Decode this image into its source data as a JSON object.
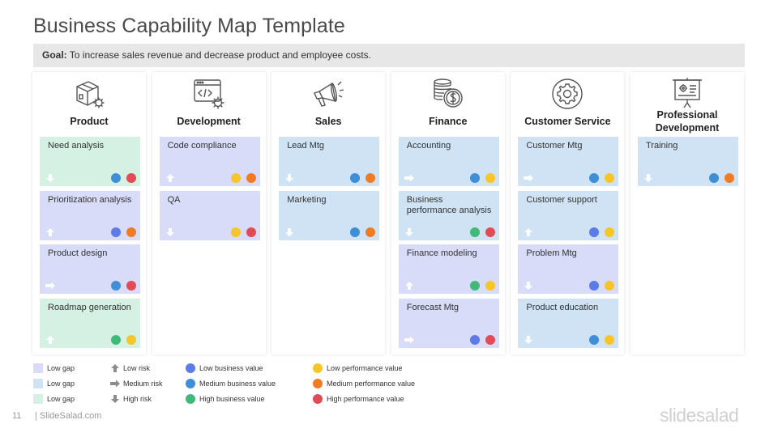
{
  "title": "Business Capability Map Template",
  "goal": {
    "label": "Goal:",
    "text": "To increase sales revenue and decrease product and employee costs."
  },
  "colors": {
    "gap_low_1": "#d8dcf8",
    "gap_low_2": "#cfe3f5",
    "gap_low_3": "#d5f1e3",
    "dot_low_business": "#5b7be6",
    "dot_medium_business": "#3f8fd6",
    "dot_high_business": "#3fba79",
    "dot_low_performance": "#f6c628",
    "dot_medium_performance": "#ef7c23",
    "dot_high_performance": "#e24a56",
    "arrow": "#ffffff",
    "legend_arrow": "#8c8c8c"
  },
  "columns": [
    {
      "title": "Product",
      "icon": "product-box-gear-icon",
      "cards": [
        {
          "label": "Need analysis",
          "gap": "green",
          "arrow": "down",
          "dots": [
            "medium_business",
            "high_performance"
          ]
        },
        {
          "label": "Prioritization analysis",
          "gap": "indigo",
          "arrow": "up",
          "dots": [
            "low_business",
            "medium_performance"
          ]
        },
        {
          "label": "Product design",
          "gap": "indigo",
          "arrow": "right",
          "dots": [
            "medium_business",
            "high_performance"
          ]
        },
        {
          "label": "Roadmap generation",
          "gap": "green",
          "arrow": "up",
          "dots": [
            "high_business",
            "low_performance"
          ]
        }
      ]
    },
    {
      "title": "Development",
      "icon": "code-window-gear-icon",
      "cards": [
        {
          "label": "Code compliance",
          "gap": "indigo",
          "arrow": "up",
          "dots": [
            "low_performance",
            "medium_performance"
          ]
        },
        {
          "label": "QA",
          "gap": "indigo",
          "arrow": "down",
          "dots": [
            "low_performance",
            "high_performance"
          ]
        }
      ]
    },
    {
      "title": "Sales",
      "icon": "megaphone-icon",
      "cards": [
        {
          "label": "Lead Mtg",
          "gap": "blue",
          "arrow": "down",
          "dots": [
            "medium_business",
            "medium_performance"
          ]
        },
        {
          "label": "Marketing",
          "gap": "blue",
          "arrow": "down",
          "dots": [
            "medium_business",
            "medium_performance"
          ]
        }
      ]
    },
    {
      "title": "Finance",
      "icon": "coins-dollar-icon",
      "cards": [
        {
          "label": "Accounting",
          "gap": "blue",
          "arrow": "right",
          "dots": [
            "medium_business",
            "low_performance"
          ]
        },
        {
          "label": "Business performance analysis",
          "gap": "blue",
          "arrow": "down",
          "dots": [
            "high_business",
            "high_performance"
          ]
        },
        {
          "label": "Finance modeling",
          "gap": "indigo",
          "arrow": "up",
          "dots": [
            "high_business",
            "low_performance"
          ]
        },
        {
          "label": "Forecast Mtg",
          "gap": "indigo",
          "arrow": "right",
          "dots": [
            "low_business",
            "high_performance"
          ]
        }
      ]
    },
    {
      "title": "Customer Service",
      "icon": "gear-circle-icon",
      "cards": [
        {
          "label": "Customer Mtg",
          "gap": "blue",
          "arrow": "right",
          "dots": [
            "medium_business",
            "low_performance"
          ]
        },
        {
          "label": "Customer support",
          "gap": "blue",
          "arrow": "up",
          "dots": [
            "low_business",
            "low_performance"
          ]
        },
        {
          "label": "Problem Mtg",
          "gap": "indigo",
          "arrow": "down",
          "dots": [
            "low_business",
            "low_performance"
          ]
        },
        {
          "label": "Product education",
          "gap": "blue",
          "arrow": "down",
          "dots": [
            "medium_business",
            "low_performance"
          ]
        }
      ]
    },
    {
      "title": "Professional Development",
      "icon": "presentation-board-icon",
      "cards": [
        {
          "label": "Training",
          "gap": "blue",
          "arrow": "down",
          "dots": [
            "medium_business",
            "medium_performance"
          ]
        }
      ]
    }
  ],
  "legend": {
    "gaps": [
      {
        "label": "Low gap",
        "color": "#d8dcf8"
      },
      {
        "label": "Low gap",
        "color": "#cfe3f5"
      },
      {
        "label": "Low gap",
        "color": "#d5f1e3"
      }
    ],
    "risks": [
      {
        "label": "Low risk",
        "arrow": "up"
      },
      {
        "label": "Medium risk",
        "arrow": "right"
      },
      {
        "label": "High risk",
        "arrow": "down"
      }
    ],
    "business": [
      {
        "label": "Low business value",
        "color": "#5b7be6"
      },
      {
        "label": "Medium business value",
        "color": "#3f8fd6"
      },
      {
        "label": "High business value",
        "color": "#3fba79"
      }
    ],
    "performance": [
      {
        "label": "Low performance value",
        "color": "#f6c628"
      },
      {
        "label": "Medium performance value",
        "color": "#ef7c23"
      },
      {
        "label": "High performance value",
        "color": "#e24a56"
      }
    ]
  },
  "footer": {
    "page_number": "11",
    "brand": "| SlideSalad.com",
    "logo": "slidesalad"
  }
}
